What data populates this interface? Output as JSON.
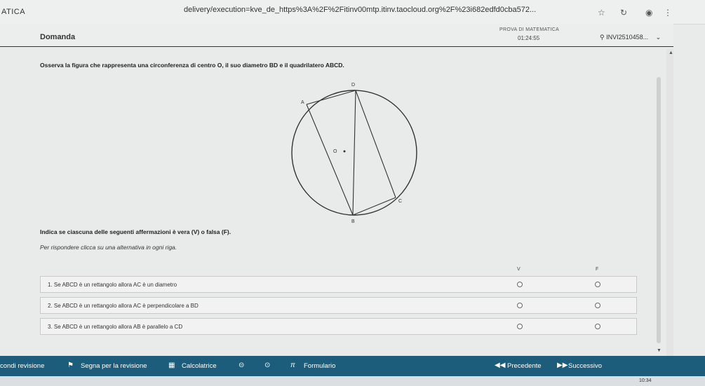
{
  "browser": {
    "tab_label": "ATICA",
    "url": "delivery/execution=kve_de_https%3A%2F%2Fitinv00mtp.itinv.taocloud.org%2F%23i682edfd0cba572...",
    "star_icon": "star-icon",
    "history_icon": "history-icon",
    "profile_icon": "profile-icon",
    "menu_icon": "kebab-menu-icon"
  },
  "header": {
    "section_label": "Domanda",
    "exam_title": "PROVA DI MATEMATICA",
    "timer": "01:24:55",
    "user_id": "INVI2510458..."
  },
  "question": {
    "text": "Osserva la figura che rappresenta una circonferenza di centro O, il suo diametro BD e il quadrilatero ABCD.",
    "figure": {
      "label_A": "A",
      "label_B": "B",
      "label_C": "C",
      "label_D": "D",
      "label_O": "O"
    },
    "instruction": "Indica se ciascuna delle seguenti affermazioni è vera (V) o falsa (F).",
    "hint": "Per rispondere clicca su una alternativa in ogni riga."
  },
  "table": {
    "col_true": "V",
    "col_false": "F",
    "rows": [
      {
        "text": "1. Se ABCD è un rettangolo allora AC è un diametro"
      },
      {
        "text": "2. Se ABCD è un rettangolo allora AC è perpendicolare a BD"
      },
      {
        "text": "3. Se ABCD è un rettangolo allora AB è parallelo a CD"
      }
    ]
  },
  "bottom": {
    "review_left": "condi revisione",
    "mark_review": "Segna per la revisione",
    "calculator": "Calcolatrice",
    "formulario": "Formulario",
    "formulario_symbol": "π",
    "prev": "Precedente",
    "next": "Successivo"
  },
  "taskbar": {
    "time": "10:34"
  }
}
